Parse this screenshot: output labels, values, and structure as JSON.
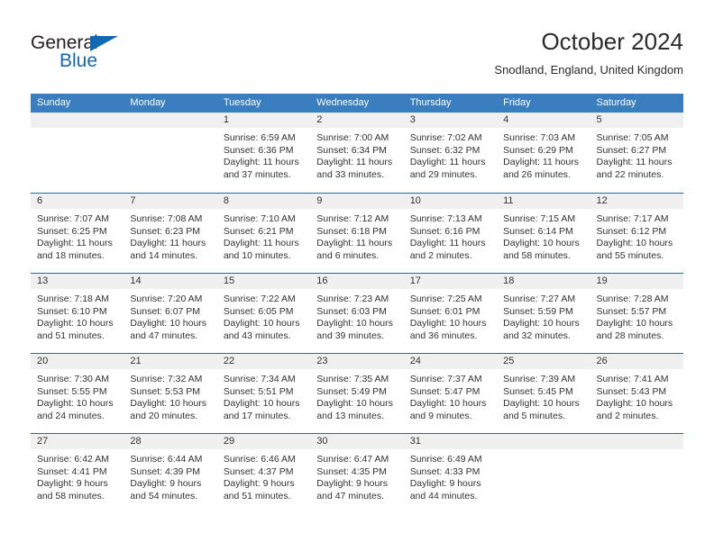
{
  "branding": {
    "logo_text_1": "General",
    "logo_text_2": "Blue",
    "logo_icon": "triangle-icon",
    "accent_color": "#1268b3"
  },
  "header": {
    "title": "October 2024",
    "subtitle": "Snodland, England, United Kingdom"
  },
  "calendar": {
    "header_bg": "#3a7ebf",
    "row_divider": "#1c6cb0",
    "daynum_bg": "#f0f0f0",
    "weekday_names": [
      "Sunday",
      "Monday",
      "Tuesday",
      "Wednesday",
      "Thursday",
      "Friday",
      "Saturday"
    ],
    "weeks": [
      [
        {
          "day": "",
          "lines": []
        },
        {
          "day": "",
          "lines": []
        },
        {
          "day": "1",
          "lines": [
            "Sunrise: 6:59 AM",
            "Sunset: 6:36 PM",
            "Daylight: 11 hours",
            "and 37 minutes."
          ]
        },
        {
          "day": "2",
          "lines": [
            "Sunrise: 7:00 AM",
            "Sunset: 6:34 PM",
            "Daylight: 11 hours",
            "and 33 minutes."
          ]
        },
        {
          "day": "3",
          "lines": [
            "Sunrise: 7:02 AM",
            "Sunset: 6:32 PM",
            "Daylight: 11 hours",
            "and 29 minutes."
          ]
        },
        {
          "day": "4",
          "lines": [
            "Sunrise: 7:03 AM",
            "Sunset: 6:29 PM",
            "Daylight: 11 hours",
            "and 26 minutes."
          ]
        },
        {
          "day": "5",
          "lines": [
            "Sunrise: 7:05 AM",
            "Sunset: 6:27 PM",
            "Daylight: 11 hours",
            "and 22 minutes."
          ]
        }
      ],
      [
        {
          "day": "6",
          "lines": [
            "Sunrise: 7:07 AM",
            "Sunset: 6:25 PM",
            "Daylight: 11 hours",
            "and 18 minutes."
          ]
        },
        {
          "day": "7",
          "lines": [
            "Sunrise: 7:08 AM",
            "Sunset: 6:23 PM",
            "Daylight: 11 hours",
            "and 14 minutes."
          ]
        },
        {
          "day": "8",
          "lines": [
            "Sunrise: 7:10 AM",
            "Sunset: 6:21 PM",
            "Daylight: 11 hours",
            "and 10 minutes."
          ]
        },
        {
          "day": "9",
          "lines": [
            "Sunrise: 7:12 AM",
            "Sunset: 6:18 PM",
            "Daylight: 11 hours",
            "and 6 minutes."
          ]
        },
        {
          "day": "10",
          "lines": [
            "Sunrise: 7:13 AM",
            "Sunset: 6:16 PM",
            "Daylight: 11 hours",
            "and 2 minutes."
          ]
        },
        {
          "day": "11",
          "lines": [
            "Sunrise: 7:15 AM",
            "Sunset: 6:14 PM",
            "Daylight: 10 hours",
            "and 58 minutes."
          ]
        },
        {
          "day": "12",
          "lines": [
            "Sunrise: 7:17 AM",
            "Sunset: 6:12 PM",
            "Daylight: 10 hours",
            "and 55 minutes."
          ]
        }
      ],
      [
        {
          "day": "13",
          "lines": [
            "Sunrise: 7:18 AM",
            "Sunset: 6:10 PM",
            "Daylight: 10 hours",
            "and 51 minutes."
          ]
        },
        {
          "day": "14",
          "lines": [
            "Sunrise: 7:20 AM",
            "Sunset: 6:07 PM",
            "Daylight: 10 hours",
            "and 47 minutes."
          ]
        },
        {
          "day": "15",
          "lines": [
            "Sunrise: 7:22 AM",
            "Sunset: 6:05 PM",
            "Daylight: 10 hours",
            "and 43 minutes."
          ]
        },
        {
          "day": "16",
          "lines": [
            "Sunrise: 7:23 AM",
            "Sunset: 6:03 PM",
            "Daylight: 10 hours",
            "and 39 minutes."
          ]
        },
        {
          "day": "17",
          "lines": [
            "Sunrise: 7:25 AM",
            "Sunset: 6:01 PM",
            "Daylight: 10 hours",
            "and 36 minutes."
          ]
        },
        {
          "day": "18",
          "lines": [
            "Sunrise: 7:27 AM",
            "Sunset: 5:59 PM",
            "Daylight: 10 hours",
            "and 32 minutes."
          ]
        },
        {
          "day": "19",
          "lines": [
            "Sunrise: 7:28 AM",
            "Sunset: 5:57 PM",
            "Daylight: 10 hours",
            "and 28 minutes."
          ]
        }
      ],
      [
        {
          "day": "20",
          "lines": [
            "Sunrise: 7:30 AM",
            "Sunset: 5:55 PM",
            "Daylight: 10 hours",
            "and 24 minutes."
          ]
        },
        {
          "day": "21",
          "lines": [
            "Sunrise: 7:32 AM",
            "Sunset: 5:53 PM",
            "Daylight: 10 hours",
            "and 20 minutes."
          ]
        },
        {
          "day": "22",
          "lines": [
            "Sunrise: 7:34 AM",
            "Sunset: 5:51 PM",
            "Daylight: 10 hours",
            "and 17 minutes."
          ]
        },
        {
          "day": "23",
          "lines": [
            "Sunrise: 7:35 AM",
            "Sunset: 5:49 PM",
            "Daylight: 10 hours",
            "and 13 minutes."
          ]
        },
        {
          "day": "24",
          "lines": [
            "Sunrise: 7:37 AM",
            "Sunset: 5:47 PM",
            "Daylight: 10 hours",
            "and 9 minutes."
          ]
        },
        {
          "day": "25",
          "lines": [
            "Sunrise: 7:39 AM",
            "Sunset: 5:45 PM",
            "Daylight: 10 hours",
            "and 5 minutes."
          ]
        },
        {
          "day": "26",
          "lines": [
            "Sunrise: 7:41 AM",
            "Sunset: 5:43 PM",
            "Daylight: 10 hours",
            "and 2 minutes."
          ]
        }
      ],
      [
        {
          "day": "27",
          "lines": [
            "Sunrise: 6:42 AM",
            "Sunset: 4:41 PM",
            "Daylight: 9 hours",
            "and 58 minutes."
          ]
        },
        {
          "day": "28",
          "lines": [
            "Sunrise: 6:44 AM",
            "Sunset: 4:39 PM",
            "Daylight: 9 hours",
            "and 54 minutes."
          ]
        },
        {
          "day": "29",
          "lines": [
            "Sunrise: 6:46 AM",
            "Sunset: 4:37 PM",
            "Daylight: 9 hours",
            "and 51 minutes."
          ]
        },
        {
          "day": "30",
          "lines": [
            "Sunrise: 6:47 AM",
            "Sunset: 4:35 PM",
            "Daylight: 9 hours",
            "and 47 minutes."
          ]
        },
        {
          "day": "31",
          "lines": [
            "Sunrise: 6:49 AM",
            "Sunset: 4:33 PM",
            "Daylight: 9 hours",
            "and 44 minutes."
          ]
        },
        {
          "day": "",
          "lines": []
        },
        {
          "day": "",
          "lines": []
        }
      ]
    ]
  }
}
